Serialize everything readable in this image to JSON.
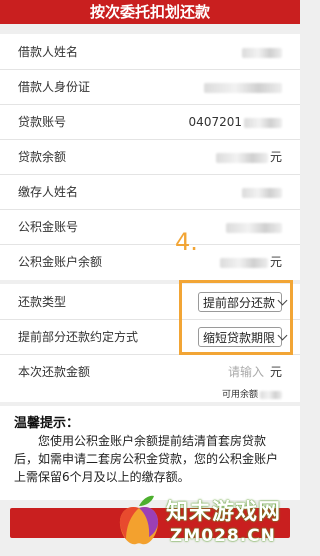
{
  "header": {
    "title": "按次委托扣划还款"
  },
  "info_rows": [
    {
      "label": "借款人姓名",
      "value": "",
      "unit": ""
    },
    {
      "label": "借款人身份证",
      "value": "",
      "unit": ""
    },
    {
      "label": "贷款账号",
      "value": "0407201",
      "unit": ""
    },
    {
      "label": "贷款余额",
      "value": "",
      "unit": "元"
    },
    {
      "label": "缴存人姓名",
      "value": "",
      "unit": ""
    },
    {
      "label": "公积金账号",
      "value": "",
      "unit": ""
    },
    {
      "label": "公积金账户余额",
      "value": "",
      "unit": "元"
    }
  ],
  "form": {
    "repay_type_label": "还款类型",
    "repay_type_value": "提前部分还款",
    "agreement_label": "提前部分还款约定方式",
    "agreement_value": "缩短贷款期限",
    "amount_label": "本次还款金额",
    "amount_placeholder": "请输入",
    "amount_unit": "元",
    "available_hint": "可用余额"
  },
  "annotation": {
    "step": "4."
  },
  "tips": {
    "title": "温馨提示：",
    "body": "您使用公积金账户余额提前结清首套房贷款后，如需申请二套房公积金贷款，您的公积金账户上需保留6个月及以上的缴存额。"
  },
  "watermark": {
    "line1": "知未游戏网",
    "line2": "ZM028.CN"
  },
  "colors": {
    "header_red": "#c91f1f",
    "annotation_orange": "#f2a535",
    "watermark_green": "#5a9c2a"
  }
}
